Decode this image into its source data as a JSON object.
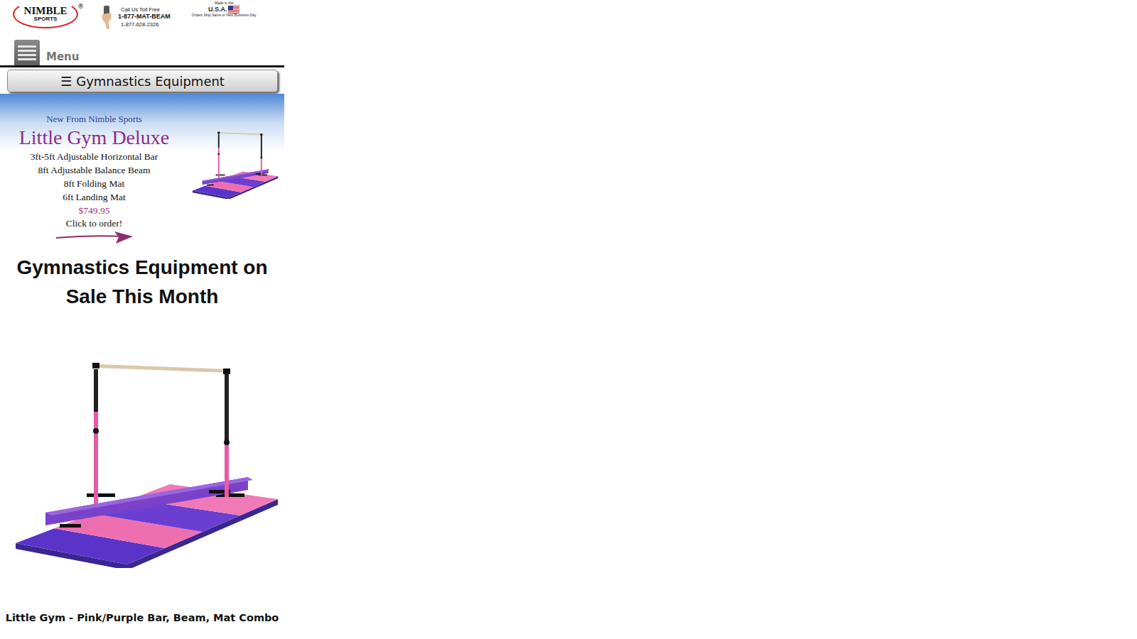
{
  "header": {
    "logo": {
      "name": "NIMBLE",
      "sub": "SPORTS",
      "mark": "®"
    },
    "phone": {
      "label": "Call Us Toll Free",
      "vanity": "1-877-MAT-BEAM",
      "number": "1-877-628-2326"
    },
    "badge": {
      "pre": "Made in the",
      "title": "U.S.A.",
      "note": "Orders Ship Same or Next Business Day"
    }
  },
  "menu": {
    "label": "Menu"
  },
  "category_button": {
    "icon": "☰",
    "label": "Gymnastics Equipment"
  },
  "banner": {
    "kicker": "New From Nimble Sports",
    "title": "Little Gym Deluxe",
    "features": [
      "3ft-5ft Adjustable Horizontal Bar",
      "8ft Adjustable Balance Beam",
      "8ft Folding Mat",
      "6ft Landing Mat"
    ],
    "price": "$749.95",
    "cta": "Click to order!"
  },
  "heading": "Gymnastics Equipment on Sale This Month",
  "products": [
    {
      "name": "Little Gym - Pink/Purple Bar, Beam, Mat Combo"
    }
  ]
}
